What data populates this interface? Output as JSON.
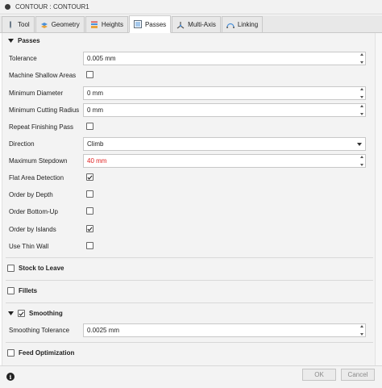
{
  "window": {
    "title": "CONTOUR : CONTOUR1"
  },
  "tabs": [
    {
      "label": "Tool",
      "icon": "tool-icon"
    },
    {
      "label": "Geometry",
      "icon": "geometry-icon"
    },
    {
      "label": "Heights",
      "icon": "heights-icon"
    },
    {
      "label": "Passes",
      "icon": "passes-icon",
      "active": true
    },
    {
      "label": "Multi-Axis",
      "icon": "multi-axis-icon"
    },
    {
      "label": "Linking",
      "icon": "linking-icon"
    }
  ],
  "passes": {
    "header": "Passes",
    "tolerance": {
      "label": "Tolerance",
      "value": "0.005 mm"
    },
    "machine_shallow_areas": {
      "label": "Machine Shallow Areas",
      "checked": false
    },
    "minimum_diameter": {
      "label": "Minimum Diameter",
      "value": "0 mm"
    },
    "minimum_cutting_radius": {
      "label": "Minimum Cutting Radius",
      "value": "0 mm"
    },
    "repeat_finishing_pass": {
      "label": "Repeat Finishing Pass",
      "checked": false
    },
    "direction": {
      "label": "Direction",
      "value": "Climb"
    },
    "maximum_stepdown": {
      "label": "Maximum Stepdown",
      "value": "40 mm",
      "value_color": "#e01f1f"
    },
    "flat_area_detection": {
      "label": "Flat Area Detection",
      "checked": true
    },
    "order_by_depth": {
      "label": "Order by Depth",
      "checked": false
    },
    "order_bottom_up": {
      "label": "Order Bottom-Up",
      "checked": false
    },
    "order_by_islands": {
      "label": "Order by Islands",
      "checked": true
    },
    "use_thin_wall": {
      "label": "Use Thin Wall",
      "checked": false
    }
  },
  "stock_to_leave": {
    "header": "Stock to Leave",
    "checked": false
  },
  "fillets": {
    "header": "Fillets",
    "checked": false
  },
  "smoothing": {
    "header": "Smoothing",
    "checked": true,
    "tolerance": {
      "label": "Smoothing Tolerance",
      "value": "0.0025 mm"
    }
  },
  "feed_optimization": {
    "header": "Feed Optimization",
    "checked": false
  },
  "footer": {
    "info_glyph": "i",
    "ok_label": "OK",
    "cancel_label": "Cancel"
  }
}
